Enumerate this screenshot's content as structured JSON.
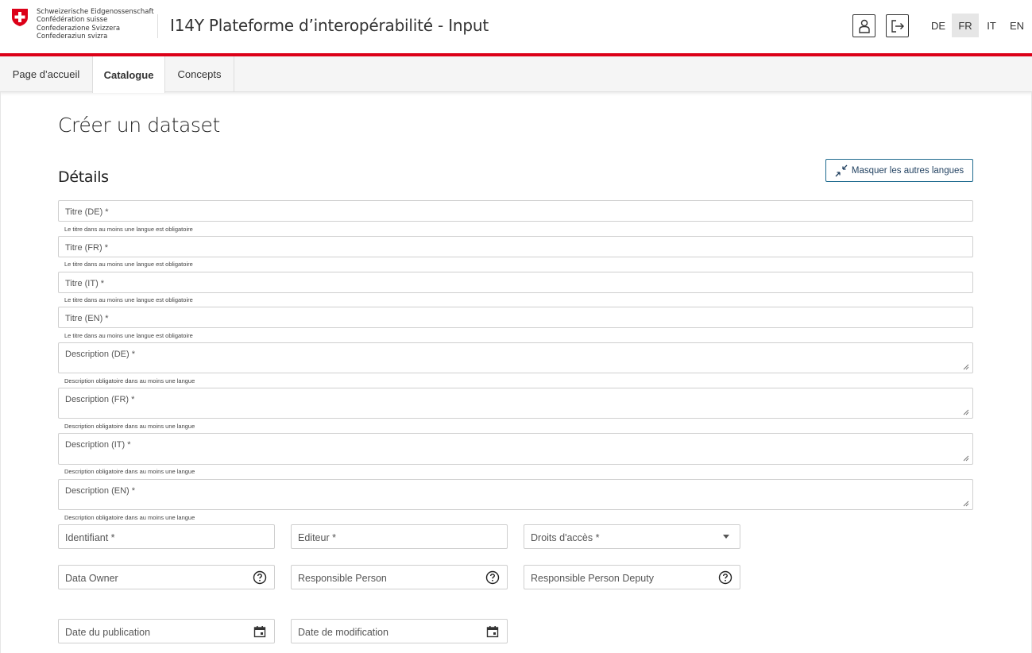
{
  "header": {
    "federal_names": [
      "Schweizerische Eidgenossenschaft",
      "Confédération suisse",
      "Confederazione Svizzera",
      "Confederaziun svizra"
    ],
    "app_title": "I14Y Plateforme d’interopérabilité - Input",
    "user_icon": "user-icon",
    "logout_icon": "logout-icon",
    "languages": [
      "DE",
      "FR",
      "IT",
      "EN"
    ],
    "active_language": "FR"
  },
  "tabs": [
    {
      "label": "Page d’accueil"
    },
    {
      "label": "Catalogue",
      "active": true
    },
    {
      "label": "Concepts"
    }
  ],
  "page": {
    "title": "Créer un dataset",
    "section_title": "Détails",
    "hide_languages_label": "Masquer les autres langues"
  },
  "form": {
    "titles": [
      {
        "label": "Titre (DE)  *",
        "hint": "Le titre dans au moins une langue est obligatoire"
      },
      {
        "label": "Titre (FR)  *",
        "hint": "Le titre dans au moins une langue est obligatoire"
      },
      {
        "label": "Titre (IT)  *",
        "hint": "Le titre dans au moins une langue est obligatoire"
      },
      {
        "label": "Titre (EN)  *",
        "hint": "Le titre dans au moins une langue est obligatoire"
      }
    ],
    "descriptions": [
      {
        "label": "Description (DE)  *",
        "hint": "Description obligatoire dans au moins une langue"
      },
      {
        "label": "Description (FR)  *",
        "hint": "Description obligatoire dans au moins une langue"
      },
      {
        "label": "Description (IT)  *",
        "hint": "Description obligatoire dans au moins une langue"
      },
      {
        "label": "Description (EN)  *",
        "hint": "Description obligatoire dans au moins une langue"
      }
    ],
    "identifier_label": "Identifiant *",
    "publisher_label": "Editeur *",
    "access_rights_label": "Droits d'accès *",
    "data_owner_label": "Data Owner",
    "responsible_person_label": "Responsible Person",
    "responsible_deputy_label": "Responsible Person Deputy",
    "publication_date_label": "Date du publication",
    "modification_date_label": "Date de modification"
  },
  "colors": {
    "swiss_red": "#dc0018",
    "accent_blue": "#1f6b8f"
  }
}
